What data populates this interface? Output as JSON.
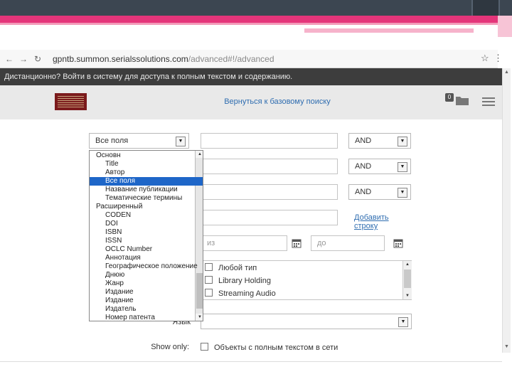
{
  "browser": {
    "url_host": "gpntb.summon.serialssolutions.com",
    "url_path": "/advanced#!/advanced"
  },
  "banner": {
    "text": "Дистанционно? Войти в систему для доступа к полным текстом и содержанию."
  },
  "header": {
    "back_link": "Вернуться к базовому поиску",
    "saved_count": "0"
  },
  "form": {
    "field_select": "Все поля",
    "operators": [
      "AND",
      "AND",
      "AND"
    ],
    "add_row_link": "Добавить строку",
    "date_from_placeholder": "из",
    "date_to_placeholder": "до",
    "content_types": [
      "Любой тип",
      "Library Holding",
      "Streaming Audio"
    ],
    "language_label": "Язык",
    "show_only_label": "Show only:",
    "fulltext_option": "Объекты с полным текстом в сети"
  },
  "dropdown": {
    "options": [
      {
        "label": "Основн",
        "group": true
      },
      {
        "label": "Title",
        "group": false
      },
      {
        "label": "Автор",
        "group": false
      },
      {
        "label": "Все поля",
        "group": false,
        "selected": true
      },
      {
        "label": "Название публикации",
        "group": false
      },
      {
        "label": "Тематические термины",
        "group": false
      },
      {
        "label": "Расширенный",
        "group": true
      },
      {
        "label": "CODEN",
        "group": false
      },
      {
        "label": "DOI",
        "group": false
      },
      {
        "label": "ISBN",
        "group": false
      },
      {
        "label": "ISSN",
        "group": false
      },
      {
        "label": "OCLC Number",
        "group": false
      },
      {
        "label": "Аннотация",
        "group": false
      },
      {
        "label": "Географическое положение",
        "group": false
      },
      {
        "label": "Днюю",
        "group": false
      },
      {
        "label": "Жанр",
        "group": false
      },
      {
        "label": "Издание",
        "group": false
      },
      {
        "label": "Издание",
        "group": false
      },
      {
        "label": "Издатель",
        "group": false
      },
      {
        "label": "Номер патента",
        "group": false
      }
    ]
  },
  "colors": {
    "slide_dark": "#3c4651",
    "slide_pink": "#e4357a",
    "link_blue": "#2f6db0",
    "selected_blue": "#1e66c8",
    "logo_red": "#7b1a1c"
  }
}
